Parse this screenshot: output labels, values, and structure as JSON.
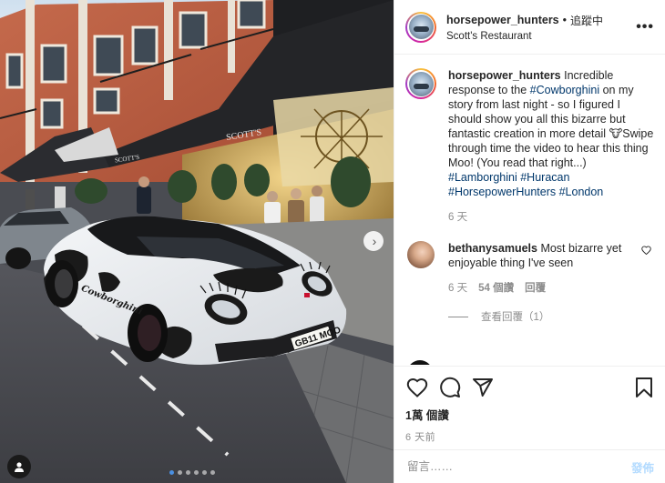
{
  "post": {
    "username": "horsepower_hunters",
    "follow_status": "追蹤中",
    "location": "Scott's Restaurant",
    "more_icon": "more-horizontal-icon"
  },
  "media": {
    "storefront_sign": "SCOTT'S",
    "awning_sign": "SCOTT'S",
    "car_script": "Cowborghini",
    "plate": "GB11 MOO",
    "slide_count": 6,
    "active_slide": 1
  },
  "caption": {
    "username": "horsepower_hunters",
    "text_1": " Incredible response to the ",
    "tag_1": "#Cowborghini",
    "text_2": " on my story from last night - so I figured I should show you all this bizarre but fantastic creation in more detail 🐮Swipe through time the video to hear this thing Moo! (You read that right...) ",
    "tag_2": "#Lamborghini",
    "tag_3": "#Huracan",
    "tag_4": "#HorsepowerHunters",
    "tag_5": "#London",
    "age": "6 天"
  },
  "comments": [
    {
      "username": "bethanysamuels",
      "text": " Most bizarre yet enjoyable thing I've seen",
      "age": "6 天",
      "likes": "54 個讚",
      "reply_label": "回覆",
      "view_replies": "查看回覆（1）"
    }
  ],
  "actions": {
    "likes_count": "1萬 個讚",
    "time_ago": "6 天前"
  },
  "composer": {
    "placeholder": "留言……",
    "post_label": "發佈"
  },
  "colors": {
    "link": "#00376b",
    "muted": "#8e8e8e",
    "post_disabled": "#b3dbff"
  }
}
